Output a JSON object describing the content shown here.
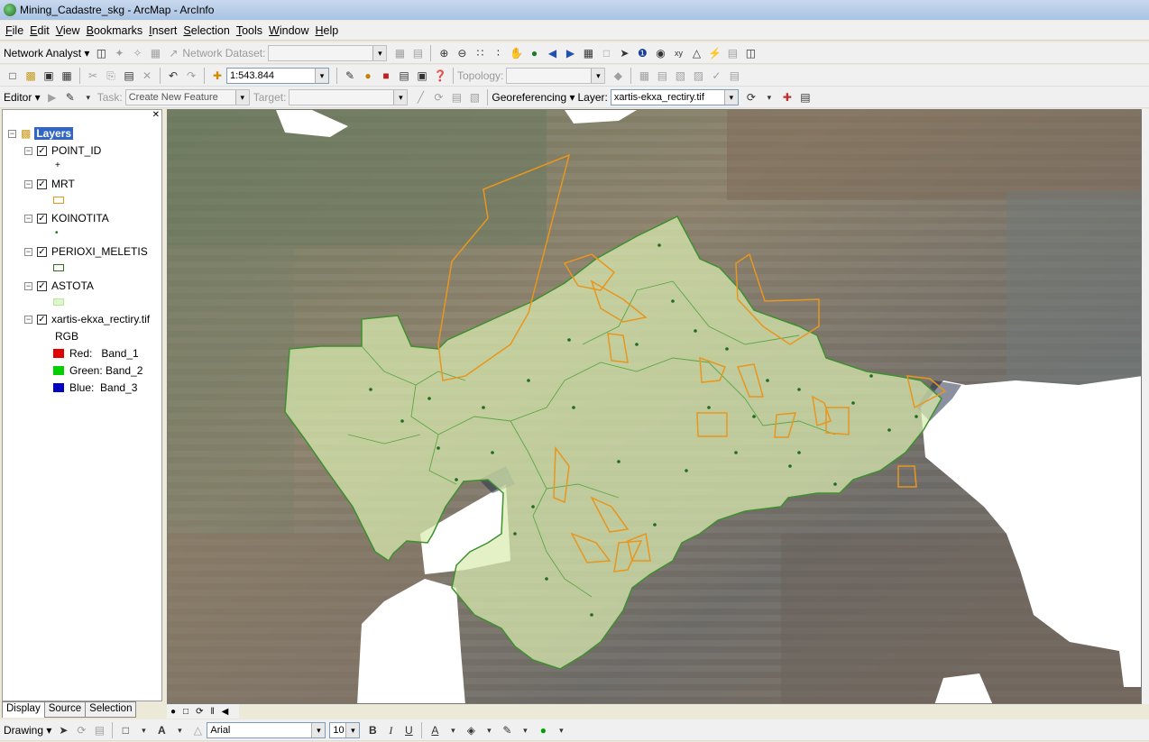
{
  "window": {
    "title": "Mining_Cadastre_skg - ArcMap - ArcInfo"
  },
  "menu": [
    "File",
    "Edit",
    "View",
    "Bookmarks",
    "Insert",
    "Selection",
    "Tools",
    "Window",
    "Help"
  ],
  "toolbar1": {
    "network_analyst": "Network Analyst ▾",
    "network_dataset_label": "Network Dataset:",
    "network_dataset_value": ""
  },
  "toolbar2": {
    "scale": "1:543.844",
    "topology_label": "Topology:",
    "topology_value": ""
  },
  "toolbar3": {
    "editor": "Editor ▾",
    "task_label": "Task:",
    "task_value": "Create New Feature",
    "target_label": "Target:",
    "target_value": "",
    "georeferencing": "Georeferencing ▾",
    "layer_label": "Layer:",
    "layer_value": "xartis-ekxa_rectiry.tif"
  },
  "toc": {
    "root": "Layers",
    "layers": [
      {
        "name": "POINT_ID",
        "symbol": "+"
      },
      {
        "name": "MRT",
        "symbol": ""
      },
      {
        "name": "KOINOTITA",
        "symbol": "•"
      },
      {
        "name": "PERIOXI_MELETIS",
        "symbol": ""
      },
      {
        "name": "ASTOTA",
        "symbol": ""
      },
      {
        "name": "xartis-ekxa_rectiry.tif",
        "symbol": ""
      }
    ],
    "raster_label": "RGB",
    "bands": [
      {
        "label": "Red:   Band_1",
        "color": "#e00000"
      },
      {
        "label": "Green: Band_2",
        "color": "#00d000"
      },
      {
        "label": "Blue:  Band_3",
        "color": "#0000c0"
      }
    ],
    "tabs": [
      "Display",
      "Source",
      "Selection"
    ]
  },
  "drawing_toolbar": {
    "drawing": "Drawing ▾",
    "font": "Arial",
    "size": "10",
    "bold": "B",
    "italic": "I",
    "underline": "U",
    "text_color_glyph": "A"
  },
  "colors": {
    "study_area": "#d9ecb0",
    "study_border": "#3f8f2f",
    "mrt": "#e8961e",
    "points": "#1f6b1f"
  }
}
